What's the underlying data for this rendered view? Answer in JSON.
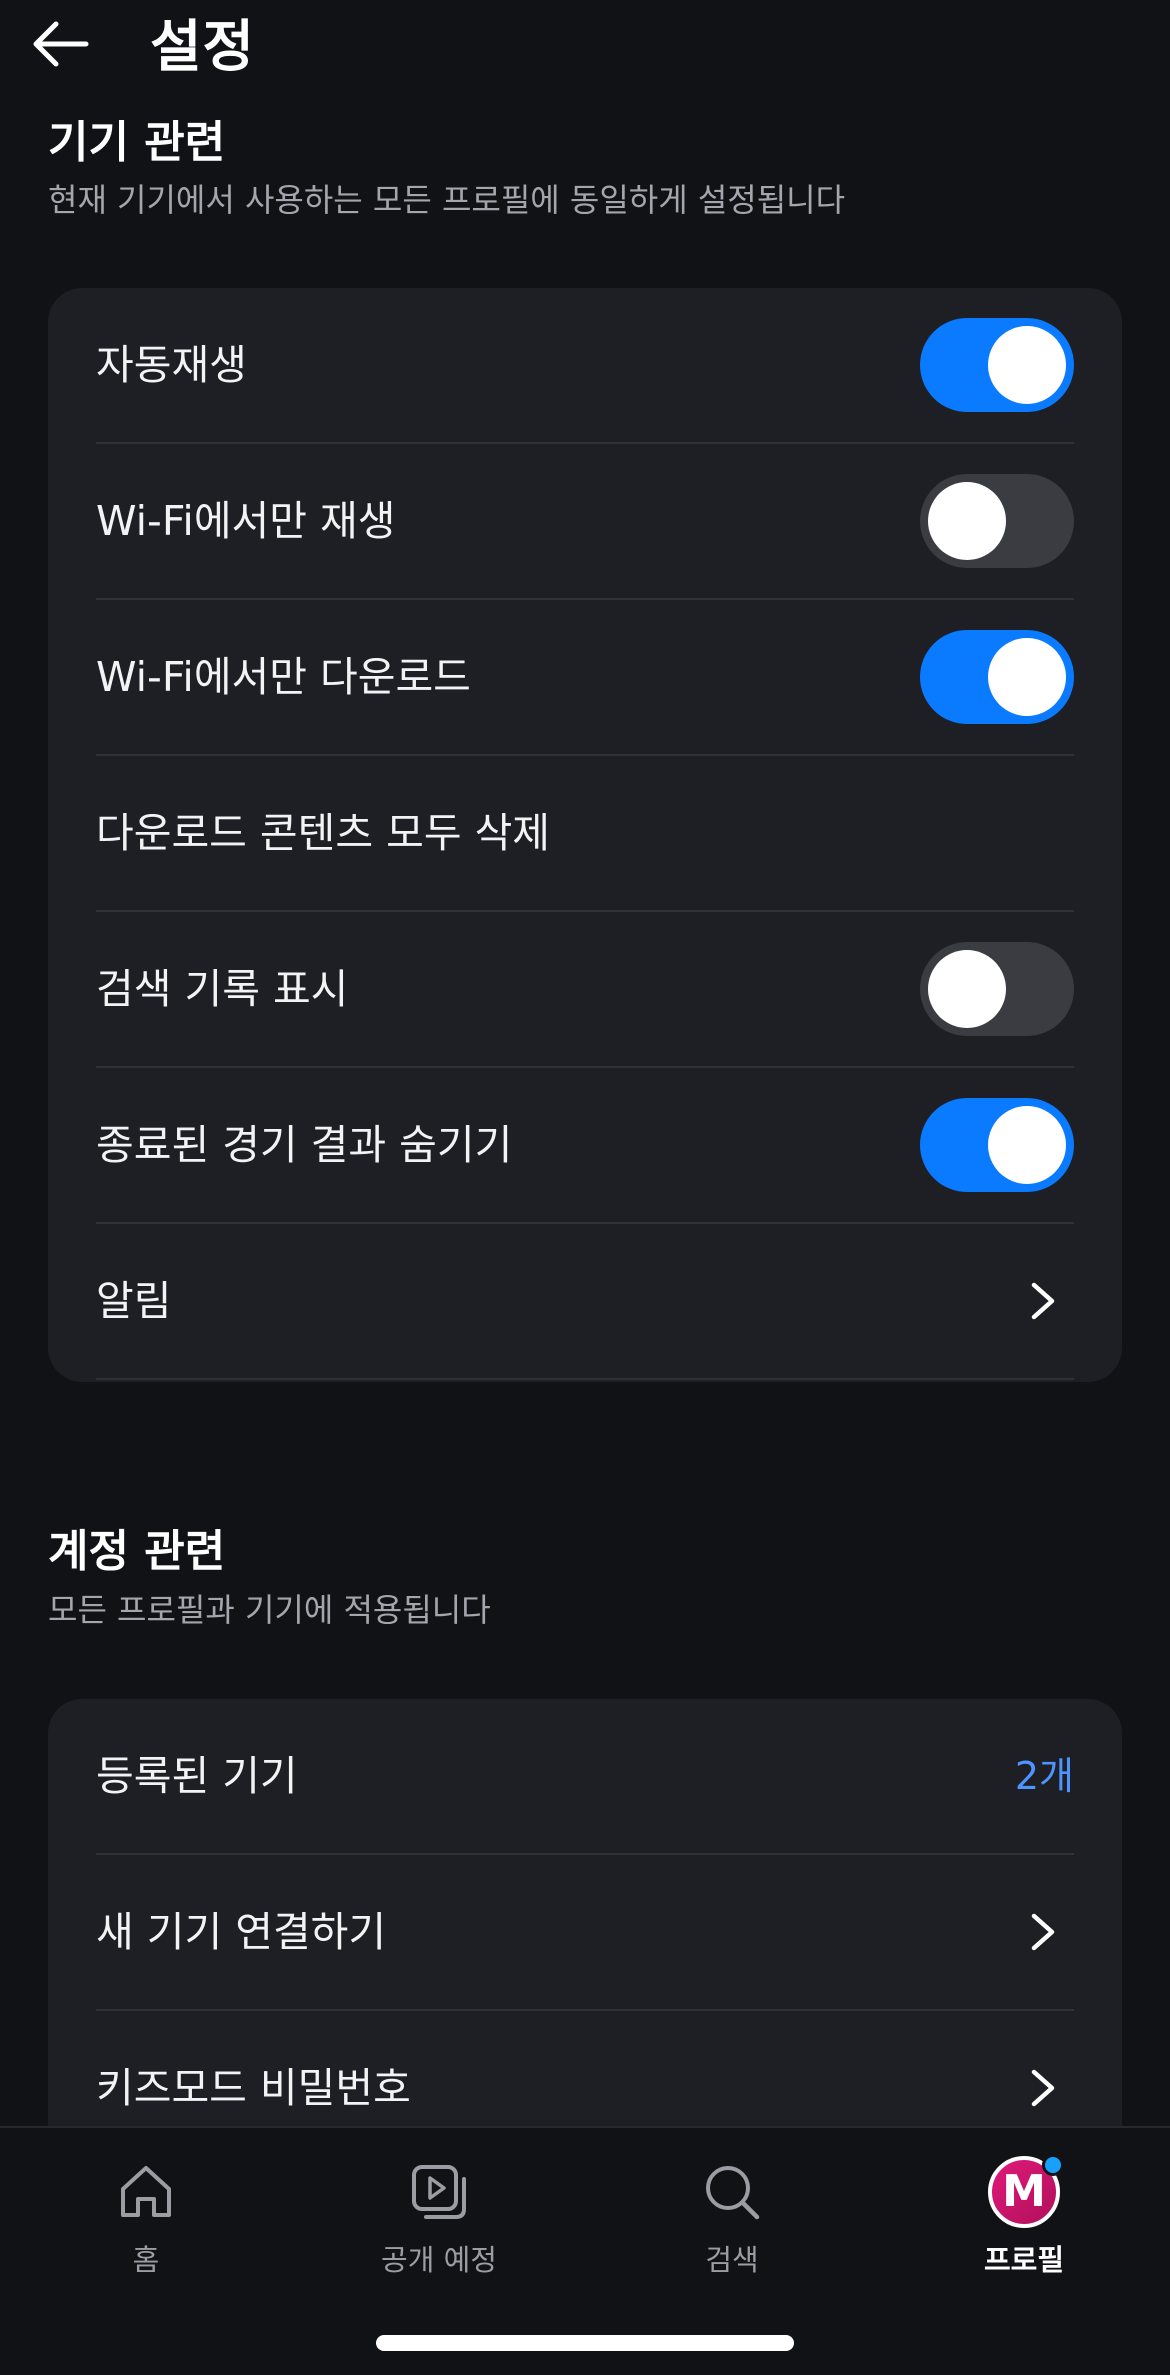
{
  "header": {
    "title": "설정",
    "back_icon": "arrow-left-icon"
  },
  "device_section": {
    "title": "기기 관련",
    "subtitle": "현재 기기에서 사용하는 모든 프로필에 동일하게 설정됩니다",
    "rows": [
      {
        "label": "자동재생",
        "type": "toggle",
        "on": true
      },
      {
        "label": "Wi-Fi에서만 재생",
        "type": "toggle",
        "on": false
      },
      {
        "label": "Wi-Fi에서만 다운로드",
        "type": "toggle",
        "on": true
      },
      {
        "label": "다운로드 콘텐츠 모두 삭제",
        "type": "action"
      },
      {
        "label": "검색 기록 표시",
        "type": "toggle",
        "on": false
      },
      {
        "label": "종료된 경기 결과 숨기기",
        "type": "toggle",
        "on": true
      },
      {
        "label": "알림",
        "type": "chevron"
      }
    ]
  },
  "account_section": {
    "title": "계정 관련",
    "subtitle": "모든 프로필과 기기에 적용됩니다",
    "rows": [
      {
        "label": "등록된 기기",
        "type": "value",
        "value": "2개"
      },
      {
        "label": "새 기기 연결하기",
        "type": "chevron"
      },
      {
        "label": "키즈모드 비밀번호",
        "type": "chevron"
      }
    ]
  },
  "bottom_nav": {
    "items": [
      {
        "label": "홈",
        "icon": "home-icon",
        "active": false
      },
      {
        "label": "공개 예정",
        "icon": "upcoming-play-icon",
        "active": false
      },
      {
        "label": "검색",
        "icon": "search-icon",
        "active": false
      },
      {
        "label": "프로필",
        "icon": "profile-avatar",
        "active": true,
        "avatar_letter": "M"
      }
    ]
  },
  "colors": {
    "background": "#111216",
    "card": "#1d1f24",
    "toggle_on": "#0a7aff",
    "toggle_off": "#3a3c42",
    "accent_value": "#4d94ff",
    "avatar": "#e01a7a"
  }
}
